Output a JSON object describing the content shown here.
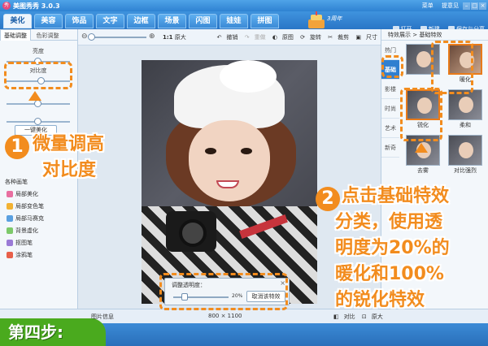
{
  "window": {
    "title": "美图秀秀 3.0.3",
    "menu": "菜单",
    "feedback": "提意见"
  },
  "nav": {
    "tabs": [
      "美化",
      "美容",
      "饰品",
      "文字",
      "边框",
      "场景",
      "闪图",
      "娃娃",
      "拼图"
    ],
    "anniversary": "3周年",
    "open": "打开",
    "new": "新建",
    "save_share": "保存与分享"
  },
  "left": {
    "tab_basic": "基础调整",
    "tab_color": "色彩调整",
    "brightness": "亮度",
    "contrast": "对比度",
    "oneclick": "一键美化",
    "brush_title": "各种画笔",
    "tools": [
      "局部美化",
      "局部变色笔",
      "局部马赛克",
      "背景虚化",
      "抠图笔",
      "涂鸦笔"
    ]
  },
  "toolbar": {
    "original_size": "原大",
    "ratio": "1:1",
    "undo": "撤销",
    "redo": "重做",
    "original": "原图",
    "rotate": "旋转",
    "crop": "裁剪",
    "resize": "尺寸"
  },
  "opacity": {
    "title": "调整透明度：",
    "value": "20%",
    "level": 0.2,
    "cancel": "取消该特效"
  },
  "right": {
    "header": "特效展示 > 基础特效",
    "categories": [
      "热门",
      "基础",
      "影楼",
      "时尚",
      "艺术",
      "新奇"
    ],
    "effects": [
      "",
      "暖化",
      "锐化",
      "柔和",
      "去雾",
      "对比强烈"
    ]
  },
  "status": {
    "info": "图片信息",
    "size": "800 × 1100",
    "compare": "对比",
    "fullsize": "原大"
  },
  "annotations": {
    "step1_num": "1",
    "step1_text_line1": "微量调高",
    "step1_text_line2": "对比度",
    "step2_num": "2",
    "step2_lines": [
      "点击基础特效",
      "分类，使用透",
      "明度为20%的",
      "暖化和100%",
      "的锐化特效"
    ],
    "step_badge": "第四步:"
  },
  "colors": {
    "accent": "#f28c1e",
    "brand_blue": "#2f82d2",
    "step_green": "#4aaa1e"
  }
}
